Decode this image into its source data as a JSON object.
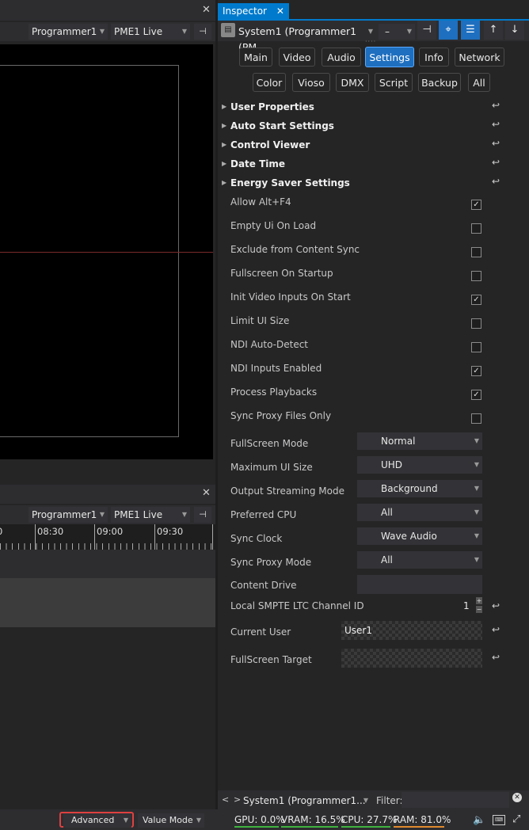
{
  "top_panel": {
    "programmer": "Programmer1",
    "live": "PME1 Live"
  },
  "bottom_panel": {
    "programmer": "Programmer1",
    "live": "PME1 Live",
    "times": [
      "0",
      "08:30",
      "09:00",
      "09:30"
    ]
  },
  "inspector": {
    "tab_label": "Inspector",
    "object_name": "System1 (Programmer1 (PM",
    "dash": "–",
    "category_row1": [
      "Main",
      "Video",
      "Audio",
      "Settings",
      "Info",
      "Network"
    ],
    "category_row2": [
      "Color",
      "Vioso",
      "DMX",
      "Script",
      "Backup",
      "All"
    ],
    "active_category": "Settings",
    "sections": [
      "User Properties",
      "Auto Start Settings",
      "Control Viewer",
      "Date Time",
      "Energy Saver Settings"
    ],
    "checkboxes": [
      {
        "label": "Allow Alt+F4",
        "checked": true
      },
      {
        "label": "Empty Ui On Load",
        "checked": false
      },
      {
        "label": "Exclude from Content Sync",
        "checked": false
      },
      {
        "label": "Fullscreen On Startup",
        "checked": false
      },
      {
        "label": "Init Video Inputs On Start",
        "checked": true
      },
      {
        "label": "Limit UI Size",
        "checked": false
      },
      {
        "label": "NDI Auto-Detect",
        "checked": false
      },
      {
        "label": "NDI Inputs Enabled",
        "checked": true
      },
      {
        "label": "Process Playbacks",
        "checked": true
      },
      {
        "label": "Sync Proxy Files Only",
        "checked": false
      }
    ],
    "selects": [
      {
        "label": "FullScreen Mode",
        "value": "Normal"
      },
      {
        "label": "Maximum UI Size",
        "value": "UHD"
      },
      {
        "label": "Output Streaming Mode",
        "value": "Background"
      },
      {
        "label": "Preferred CPU",
        "value": "All"
      },
      {
        "label": "Sync Clock",
        "value": "Wave Audio"
      },
      {
        "label": "Sync Proxy Mode",
        "value": "All"
      }
    ],
    "content_drive_label": "Content Drive",
    "content_drive_value": "",
    "ltc_label": "Local SMPTE LTC Channel ID",
    "ltc_value": "1",
    "current_user_label": "Current User",
    "current_user_value": "User1",
    "fullscreen_target_label": "FullScreen Target",
    "fullscreen_target_value": "",
    "footer_object": "System1 (Programmer1...",
    "filter_label": "Filter:",
    "filter_value": ""
  },
  "status_bar": {
    "mode": "Advanced",
    "value_mode": "Value Mode",
    "gpu": "GPU: 0.0%",
    "vram": "VRAM: 16.5%",
    "cpu": "CPU: 27.7%",
    "ram": "RAM: 81.0%",
    "colors": {
      "gpu": "#3fb23f",
      "vram": "#3fb23f",
      "cpu": "#3fb23f",
      "ram": "#e08a2e",
      "highlight": "#e04040"
    }
  }
}
